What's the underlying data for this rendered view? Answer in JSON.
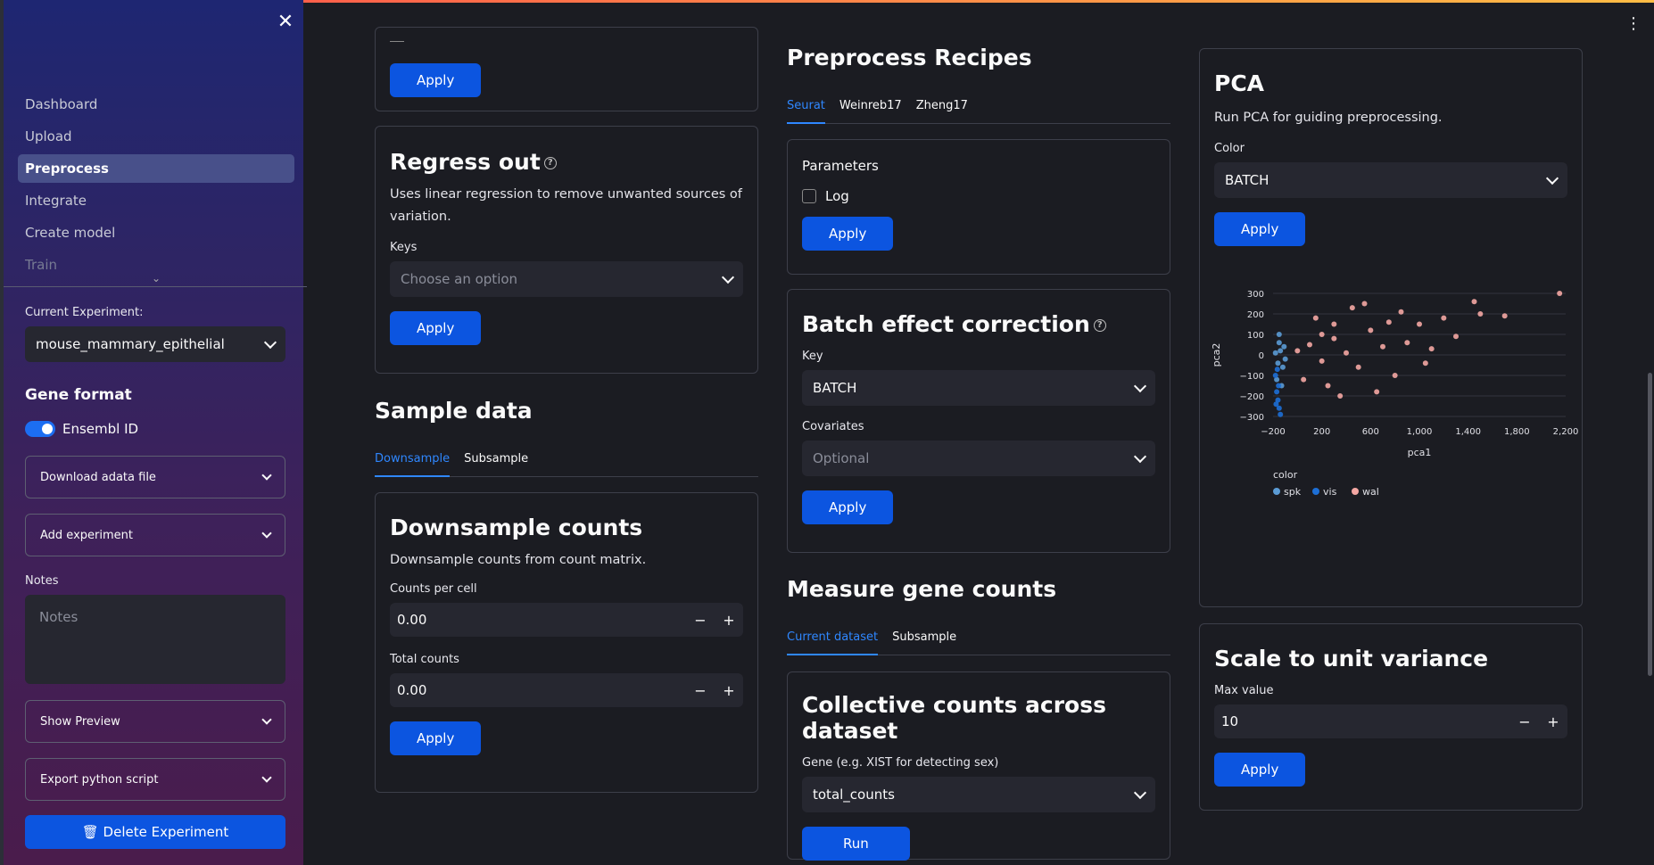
{
  "sidebar": {
    "nav": [
      "Dashboard",
      "Upload",
      "Preprocess",
      "Integrate",
      "Create model",
      "Train"
    ],
    "active": "Preprocess",
    "current_experiment_label": "Current Experiment:",
    "current_experiment_value": "mouse_mammary_epithelial",
    "gene_format_title": "Gene format",
    "ensembl_toggle_label": "Ensembl ID",
    "download_label": "Download adata file",
    "add_experiment_label": "Add experiment",
    "notes_label": "Notes",
    "notes_placeholder": "Notes",
    "show_preview_label": "Show Preview",
    "export_label": "Export python script",
    "delete_label": "Delete Experiment",
    "delete_icon": "🗑"
  },
  "col1": {
    "top_apply": "Apply",
    "regress": {
      "title": "Regress out",
      "desc": "Uses linear regression to remove unwanted sources of variation.",
      "keys_label": "Keys",
      "keys_placeholder": "Choose an option",
      "apply": "Apply"
    },
    "sample_title": "Sample data",
    "sample_tabs": [
      "Downsample",
      "Subsample"
    ],
    "downsample": {
      "title": "Downsample counts",
      "desc": "Downsample counts from count matrix.",
      "counts_label": "Counts per cell",
      "counts_value": "0.00",
      "total_label": "Total counts",
      "total_value": "0.00",
      "apply": "Apply"
    }
  },
  "col2": {
    "recipes_title": "Preprocess Recipes",
    "recipe_tabs": [
      "Seurat",
      "Weinreb17",
      "Zheng17"
    ],
    "params": {
      "title": "Parameters",
      "log_label": "Log",
      "apply": "Apply"
    },
    "batch": {
      "title": "Batch effect correction",
      "key_label": "Key",
      "key_value": "BATCH",
      "cov_label": "Covariates",
      "cov_placeholder": "Optional",
      "apply": "Apply"
    },
    "measure_title": "Measure gene counts",
    "measure_tabs": [
      "Current dataset",
      "Subsample"
    ],
    "collective": {
      "title": "Collective counts across dataset",
      "gene_label": "Gene (e.g. XIST for detecting sex)",
      "gene_value": "total_counts",
      "run": "Run"
    }
  },
  "col3": {
    "pca": {
      "title": "PCA",
      "desc": "Run PCA for guiding preprocessing.",
      "color_label": "Color",
      "color_value": "BATCH",
      "apply": "Apply"
    },
    "scale": {
      "title": "Scale to unit variance",
      "max_label": "Max value",
      "max_value": "10",
      "apply": "Apply"
    }
  },
  "chart_data": {
    "type": "scatter",
    "xlabel": "pca1",
    "ylabel": "pca2",
    "x_ticks": [
      "−200",
      "200",
      "600",
      "1,000",
      "1,400",
      "1,800",
      "2,200"
    ],
    "y_ticks": [
      "300",
      "200",
      "100",
      "0",
      "−100",
      "−200",
      "−300"
    ],
    "xlim": [
      -200,
      2200
    ],
    "ylim": [
      -300,
      300
    ],
    "legend_title": "color",
    "series": [
      {
        "name": "spk",
        "color": "#5b9bd5",
        "values": [
          [
            -180,
            10
          ],
          [
            -160,
            -40
          ],
          [
            -150,
            60
          ],
          [
            -170,
            -120
          ],
          [
            -140,
            20
          ],
          [
            -120,
            -60
          ],
          [
            -150,
            100
          ],
          [
            -130,
            -150
          ],
          [
            -110,
            40
          ],
          [
            -100,
            -20
          ]
        ]
      },
      {
        "name": "vis",
        "color": "#1d6fd6",
        "values": [
          [
            -170,
            -180
          ],
          [
            -160,
            -220
          ],
          [
            -150,
            -260
          ],
          [
            -175,
            -240
          ],
          [
            -155,
            -150
          ],
          [
            -140,
            -290
          ],
          [
            -165,
            -70
          ],
          [
            -180,
            -100
          ]
        ]
      },
      {
        "name": "wal",
        "color": "#f4a7a3",
        "values": [
          [
            0,
            20
          ],
          [
            100,
            50
          ],
          [
            200,
            -30
          ],
          [
            300,
            80
          ],
          [
            400,
            10
          ],
          [
            500,
            -60
          ],
          [
            600,
            120
          ],
          [
            700,
            40
          ],
          [
            800,
            -100
          ],
          [
            900,
            60
          ],
          [
            1000,
            150
          ],
          [
            1100,
            30
          ],
          [
            1200,
            180
          ],
          [
            1300,
            90
          ],
          [
            1500,
            200
          ],
          [
            1700,
            190
          ],
          [
            2150,
            300
          ],
          [
            1450,
            260
          ],
          [
            250,
            -150
          ],
          [
            350,
            -200
          ],
          [
            150,
            180
          ],
          [
            450,
            230
          ],
          [
            650,
            -180
          ],
          [
            50,
            -120
          ],
          [
            550,
            250
          ],
          [
            750,
            160
          ],
          [
            850,
            210
          ],
          [
            1050,
            -40
          ],
          [
            300,
            150
          ],
          [
            200,
            100
          ]
        ]
      }
    ]
  }
}
